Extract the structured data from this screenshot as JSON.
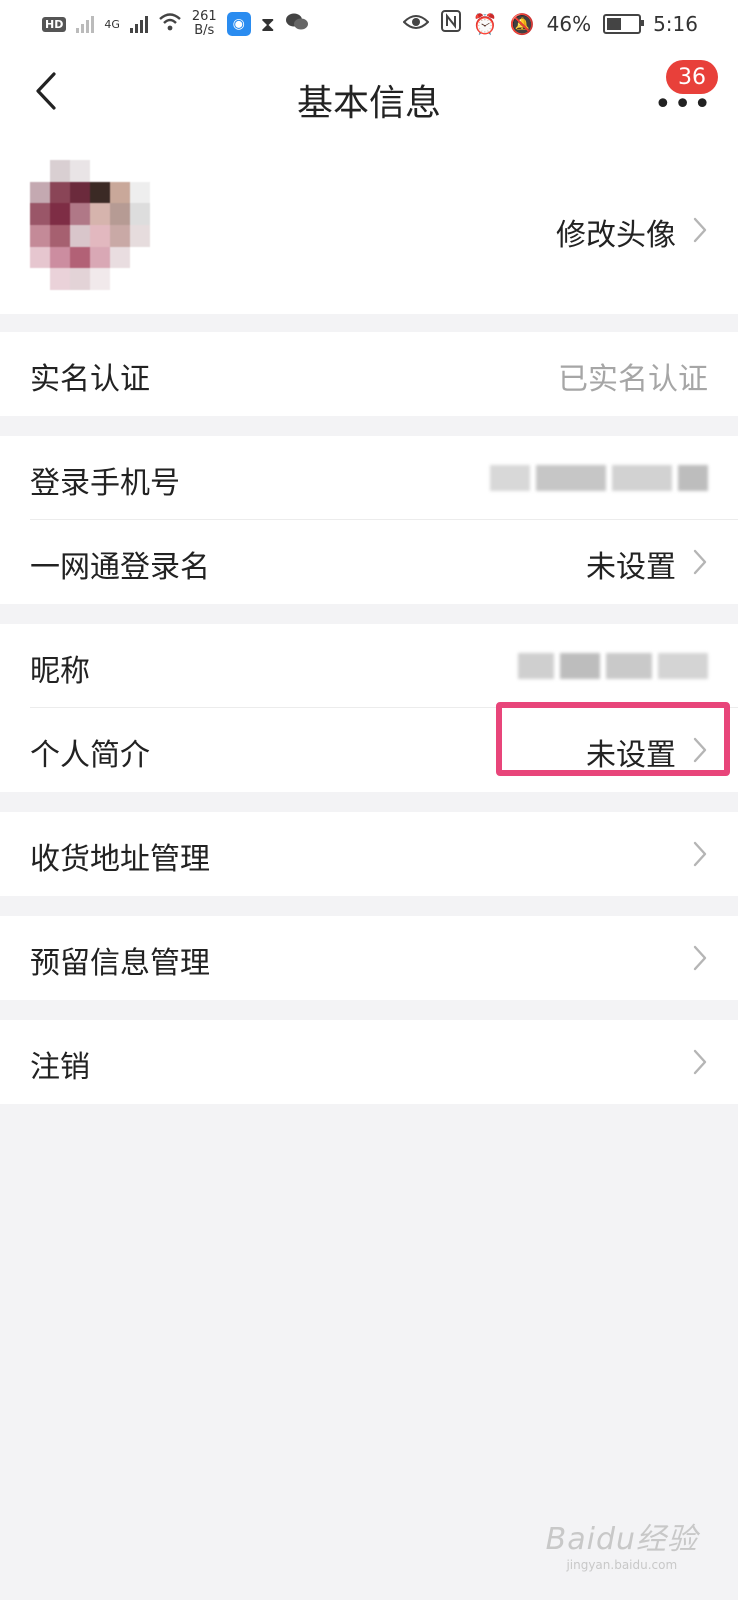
{
  "status_bar": {
    "hd_label": "HD",
    "net_speed_value": "261",
    "net_speed_unit": "B/s",
    "network_type": "4G",
    "battery_percent": "46%",
    "battery_level": 0.46,
    "time": "5:16",
    "icons": [
      "hd-icon",
      "no-signal-icon",
      "signal-icon",
      "wifi-icon",
      "app-icon",
      "hourglass-icon",
      "wechat-icon",
      "eye-icon",
      "nfc-icon",
      "alarm-icon",
      "mute-icon",
      "battery-icon"
    ]
  },
  "navbar": {
    "title": "基本信息",
    "more_badge": "36"
  },
  "profile": {
    "change_avatar_label": "修改头像"
  },
  "verification": {
    "label": "实名认证",
    "value": "已实名认证"
  },
  "account": {
    "phone_label": "登录手机号",
    "login_name_label": "一网通登录名",
    "login_name_value": "未设置"
  },
  "personal": {
    "nickname_label": "昵称",
    "bio_label": "个人简介",
    "bio_value": "未设置"
  },
  "menu": {
    "address_label": "收货地址管理",
    "reserved_info_label": "预留信息管理",
    "cancel_label": "注销"
  },
  "colors": {
    "highlight": "#e8457a",
    "badge": "#e8403a",
    "background": "#f3f3f5"
  },
  "watermark": {
    "text": "Baidu经验",
    "sub": "jingyan.baidu.com"
  }
}
